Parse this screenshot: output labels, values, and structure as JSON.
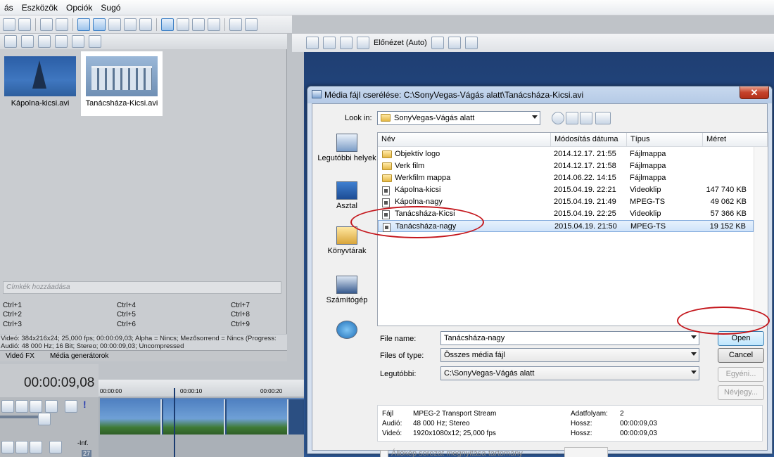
{
  "app": {
    "menu": [
      "ás",
      "Eszközök",
      "Opciók",
      "Sugó"
    ],
    "preview_label": "Előnézet (Auto)",
    "media": [
      {
        "name": "Kápolna-kicsi.avi"
      },
      {
        "name": "Tanácsháza-Kicsi.avi"
      }
    ],
    "tags_placeholder": "Címkék hozzáadása",
    "shortcuts": [
      "Ctrl+1",
      "Ctrl+4",
      "Ctrl+7",
      "Ctrl+2",
      "Ctrl+5",
      "Ctrl+8",
      "Ctrl+3",
      "Ctrl+6",
      "Ctrl+9"
    ],
    "info_line1": "Videó: 384x216x24; 25,000 fps; 00:00:09,03; Alpha = Nincs; Mezősorrend = Nincs (Progress:",
    "info_line2": "Audió: 48 000 Hz; 16 Bit; Stereo; 00:00:09,03; Uncompressed",
    "tabs": [
      "Videó FX",
      "Média generátorok"
    ],
    "timecode": "00:00:09,08",
    "ruler": [
      "00:00:00",
      "00:00:10",
      "00:00:20"
    ],
    "track_level": "-Inf.",
    "track_num": "27"
  },
  "dialog": {
    "title": "Média fájl cserélése: C:\\SonyVegas-Vágás alatt\\Tanácsháza-Kicsi.avi",
    "close": "✕",
    "look_in_label": "Look in:",
    "look_in_value": "SonyVegas-Vágás alatt",
    "places": [
      "Legutóbbi helyek",
      "Asztal",
      "Könyvtárak",
      "Számítógép",
      ""
    ],
    "columns": [
      "Név",
      "Módosítás dátuma",
      "Típus",
      "Méret"
    ],
    "files": [
      {
        "name": "Objektív logo",
        "date": "2014.12.17. 21:55",
        "type": "Fájlmappa",
        "size": "",
        "kind": "folder"
      },
      {
        "name": "Verk film",
        "date": "2014.12.17. 21:58",
        "type": "Fájlmappa",
        "size": "",
        "kind": "folder"
      },
      {
        "name": "Werkfilm mappa",
        "date": "2014.06.22. 14:15",
        "type": "Fájlmappa",
        "size": "",
        "kind": "folder"
      },
      {
        "name": "Kápolna-kicsi",
        "date": "2015.04.19. 22:21",
        "type": "Videoklip",
        "size": "147 740 KB",
        "kind": "file"
      },
      {
        "name": "Kápolna-nagy",
        "date": "2015.04.19. 21:49",
        "type": "MPEG-TS",
        "size": "49 062 KB",
        "kind": "file"
      },
      {
        "name": "Tanácsháza-Kicsi",
        "date": "2015.04.19. 22:25",
        "type": "Videoklip",
        "size": "57 366 KB",
        "kind": "file"
      },
      {
        "name": "Tanácsháza-nagy",
        "date": "2015.04.19. 21:50",
        "type": "MPEG-TS",
        "size": "19 152 KB",
        "kind": "file",
        "selected": true
      }
    ],
    "file_name_label": "File name:",
    "file_name_value": "Tanácsháza-nagy",
    "files_of_type_label": "Files of type:",
    "files_of_type_value": "Összes média fájl",
    "recent_label": "Legutóbbi:",
    "recent_value": "C:\\SonyVegas-Vágás alatt",
    "buttons": {
      "open": "Open",
      "cancel": "Cancel",
      "other": "Egyéni...",
      "props": "Névjegy..."
    },
    "info": {
      "file_label": "Fájl",
      "file_value": "MPEG-2 Transport Stream",
      "audio_label": "Audió:",
      "audio_value": "48 000 Hz; Stereo",
      "video_label": "Videó:",
      "video_value": "1920x1080x12; 25,000 fps",
      "streams_label": "Adatfolyam:",
      "streams_value": "2",
      "len1_label": "Hossz:",
      "len1_value": "00:00:09,03",
      "len2_label": "Hossz:",
      "len2_value": "00:00:09,03"
    },
    "sequence_label": "Állókép sorozat megnyitása",
    "range_label": "tartomány",
    "range_dash": "-"
  },
  "colors": {
    "annotation": "#c4161c",
    "selection": "#cfe3fa"
  }
}
